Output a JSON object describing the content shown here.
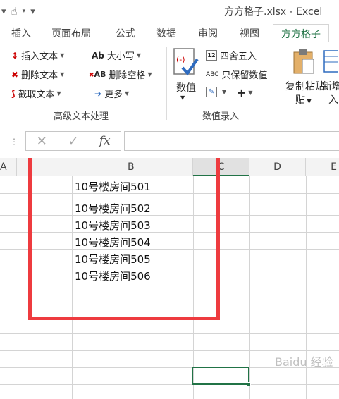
{
  "window": {
    "title": "方方格子.xlsx - Excel"
  },
  "tabs": [
    {
      "label": "插入"
    },
    {
      "label": "页面布局"
    },
    {
      "label": "公式"
    },
    {
      "label": "数据"
    },
    {
      "label": "审阅"
    },
    {
      "label": "视图"
    },
    {
      "label": "方方格子",
      "active": true
    }
  ],
  "ribbon": {
    "text_group": {
      "label": "高级文本处理",
      "insert_text": "插入文本",
      "delete_text": "删除文本",
      "extract_text": "截取文本",
      "case": "大小写",
      "case_icon_text": "Ab",
      "delete_spaces": "删除空格",
      "delete_spaces_icon_text": "AB",
      "more": "更多"
    },
    "number_group": {
      "label": "数值录入",
      "value": "数值",
      "round": "四舍五入",
      "keep_numbers": "只保留数值",
      "keep_numbers_icon_text": "ABC",
      "plus": "+"
    },
    "copy_paste": "复制粘贴",
    "copy_paste_line2": "贴",
    "new": "新增",
    "new_line2": "入"
  },
  "formula_bar": {
    "cancel": "✕",
    "confirm": "✓",
    "fx": "fx",
    "value": ""
  },
  "columns": [
    "A",
    "B",
    "C",
    "D",
    "E"
  ],
  "cells": [
    "10号楼房间501",
    "10号楼房间502",
    "10号楼房间503",
    "10号楼房间504",
    "10号楼房间505",
    "10号楼房间506"
  ],
  "watermark": "Baidu 经验",
  "colors": {
    "accent": "#217346",
    "highlight_border": "#ee3b3f"
  }
}
